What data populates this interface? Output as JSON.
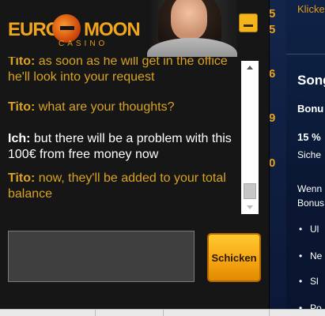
{
  "chat": {
    "brand": {
      "euro": "EURO",
      "moon": "MOON",
      "casino": "CASINO"
    },
    "messages": [
      {
        "sender": "Tito:",
        "text": " as soon as he will get in the office he'll look into your request",
        "role": "agent"
      },
      {
        "sender": "Tito:",
        "text": " what are your thoughts?",
        "role": "agent"
      },
      {
        "sender": "Ich:",
        "text": " but there will be a problem with this 100€ from free money now",
        "role": "user"
      },
      {
        "sender": "Tito:",
        "text": " now, they'll be added to your total balance",
        "role": "agent"
      }
    ],
    "input": {
      "value": "",
      "placeholder": ""
    },
    "send_label": "Schicken"
  },
  "background": {
    "top_link": "Klicke",
    "heading": "Song",
    "bonus": "Bonu",
    "percent": "15 %",
    "sub": "Siche",
    "para_line1": "Wenn",
    "para_line2": "Bonus",
    "list": [
      "Ul",
      "Ne",
      "Sl",
      "Po"
    ],
    "numbers": [
      "5",
      "5",
      "6",
      "9",
      "0"
    ]
  },
  "colors": {
    "accent": "#f3b51b",
    "agent_text": "#d9a323",
    "user_text": "#ffffff"
  }
}
